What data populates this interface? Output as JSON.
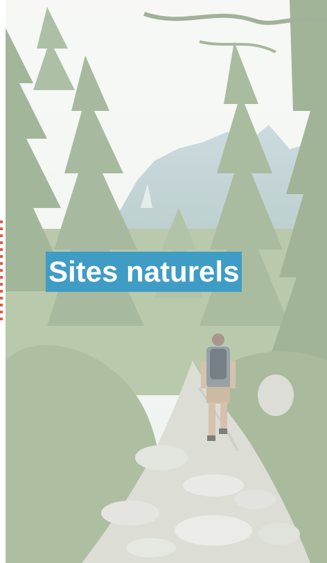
{
  "card": {
    "title": "Sites naturels",
    "image": "forest-hiking-trail-photo"
  },
  "colors": {
    "title_background": "#3f9cc5",
    "title_text": "#ffffff",
    "edge_dots": "#e05a4a"
  }
}
